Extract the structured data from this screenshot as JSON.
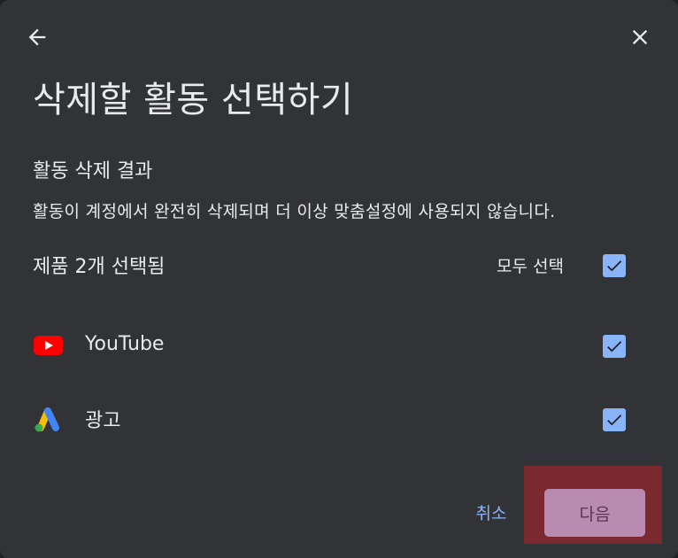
{
  "dialog": {
    "title": "삭제할 활동 선택하기",
    "back_icon": "arrow-back-icon",
    "close_icon": "close-icon"
  },
  "section": {
    "heading": "활동 삭제 결과",
    "description": "활동이 계정에서 완전히 삭제되며 더 이상 맞춤설정에 사용되지 않습니다."
  },
  "selection": {
    "count_label": "제품 2개 선택됨",
    "select_all_label": "모두 선택",
    "select_all_checked": true
  },
  "products": [
    {
      "label": "YouTube",
      "icon": "youtube-icon",
      "checked": true
    },
    {
      "label": "광고",
      "icon": "google-ads-icon",
      "checked": true
    }
  ],
  "footer": {
    "cancel_label": "취소",
    "next_label": "다음"
  },
  "colors": {
    "background": "#323336",
    "accent": "#8ab4f8",
    "next_button": "#b98bb0",
    "highlight": "#7a2a2f"
  }
}
